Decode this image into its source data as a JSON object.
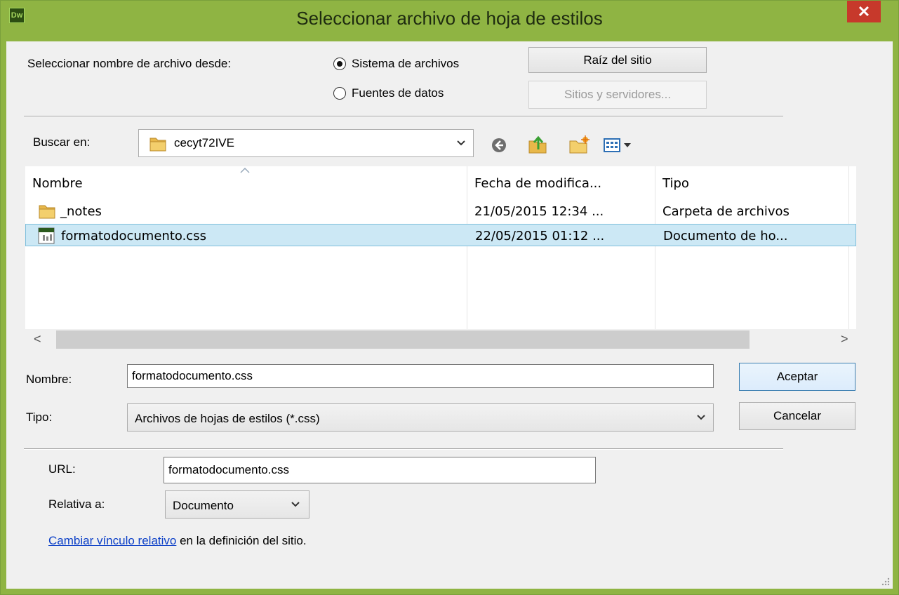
{
  "window": {
    "title": "Seleccionar archivo de hoja de estilos",
    "app_badge": "Dw",
    "close_glyph": "✕",
    "accent_color": "#8fb443"
  },
  "source": {
    "label": "Seleccionar nombre de archivo desde:",
    "option_filesystem": "Sistema de archivos",
    "option_datasources": "Fuentes de datos",
    "selected": "Sistema de archivos",
    "site_root_button": "Raíz del sitio",
    "sites_servers_button": "Sitios y servidores..."
  },
  "lookin": {
    "label": "Buscar en:",
    "value": "cecyt72IVE"
  },
  "file_list": {
    "columns": [
      "Nombre",
      "Fecha de modifica...",
      "Tipo"
    ],
    "rows": [
      {
        "name": "_notes",
        "date": "21/05/2015 12:34 ...",
        "type": "Carpeta de archivos",
        "icon": "folder-icon",
        "selected": false
      },
      {
        "name": "formatodocumento.css",
        "date": "22/05/2015 01:12 ...",
        "type": "Documento de ho...",
        "icon": "css-file-icon",
        "selected": true
      }
    ],
    "scroll_left": "<",
    "scroll_right": ">"
  },
  "name_field": {
    "label": "Nombre:",
    "value": "formatodocumento.css"
  },
  "type_field": {
    "label": "Tipo:",
    "value": "Archivos de hojas de estilos (*.css)"
  },
  "buttons": {
    "accept": "Aceptar",
    "cancel": "Cancelar"
  },
  "url_field": {
    "label": "URL:",
    "value": "formatodocumento.css"
  },
  "relative": {
    "label": "Relativa a:",
    "value": "Documento"
  },
  "footer": {
    "link": "Cambiar vínculo relativo",
    "text": "en la definición del sitio."
  }
}
